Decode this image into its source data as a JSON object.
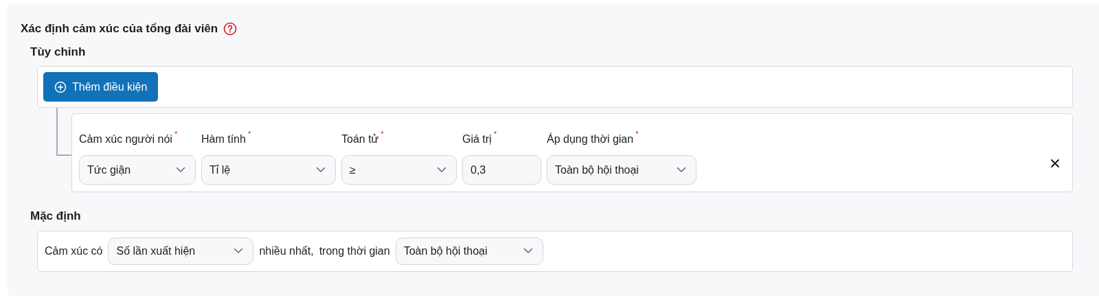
{
  "section": {
    "title": "Xác định cảm xúc của tổng đài viên"
  },
  "custom": {
    "heading": "Tùy chỉnh",
    "add_button": "Thêm điều kiện",
    "condition": {
      "fields": [
        {
          "label": "Cảm xúc người nói",
          "required_mark": "*",
          "kind": "select",
          "value": "Tức giận"
        },
        {
          "label": "Hàm tính",
          "required_mark": "*",
          "kind": "select",
          "value": "Tỉ lệ"
        },
        {
          "label": "Toán tử",
          "required_mark": "*",
          "kind": "select",
          "value": "≥"
        },
        {
          "label": "Giá trị",
          "required_mark": "*",
          "kind": "input",
          "value": "0,3"
        },
        {
          "label": "Áp dụng thời gian",
          "required_mark": "*",
          "kind": "select",
          "value": "Toàn bộ hội thoại"
        }
      ]
    }
  },
  "default": {
    "heading": "Mặc định",
    "parts": [
      {
        "kind": "text",
        "text": "Cảm xúc có"
      },
      {
        "kind": "select",
        "value": "Số lần xuất hiện"
      },
      {
        "kind": "text",
        "text": "nhiều nhất,"
      },
      {
        "kind": "text",
        "text": "trong thời gian"
      },
      {
        "kind": "select",
        "value": "Toàn bộ hội thoại"
      }
    ]
  }
}
